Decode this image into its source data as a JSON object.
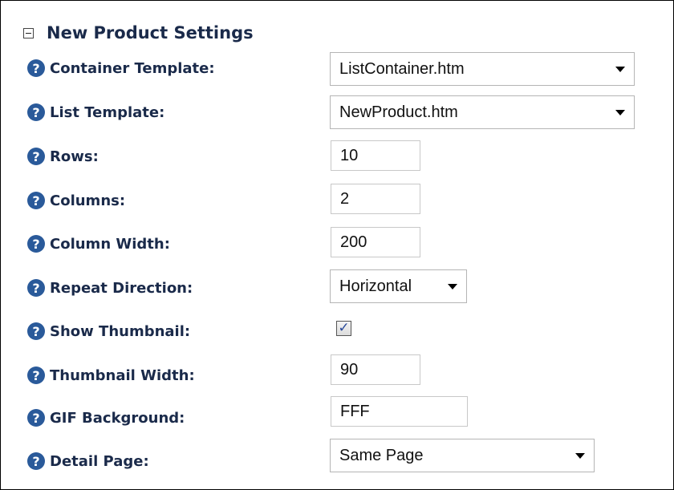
{
  "section": {
    "title": "New Product Settings"
  },
  "help_icon_glyph": "?",
  "fields": {
    "container_template": {
      "label": "Container Template:",
      "value": "ListContainer.htm"
    },
    "list_template": {
      "label": "List Template:",
      "value": "NewProduct.htm"
    },
    "rows": {
      "label": "Rows:",
      "value": "10"
    },
    "columns": {
      "label": "Columns:",
      "value": "2"
    },
    "column_width": {
      "label": "Column Width:",
      "value": "200"
    },
    "repeat_direction": {
      "label": "Repeat Direction:",
      "value": "Horizontal"
    },
    "show_thumbnail": {
      "label": "Show Thumbnail:",
      "checked": true,
      "check_glyph": "✓"
    },
    "thumbnail_width": {
      "label": "Thumbnail Width:",
      "value": "90"
    },
    "gif_background": {
      "label": "GIF Background:",
      "value": "FFF"
    },
    "detail_page": {
      "label": "Detail Page:",
      "value": "Same Page"
    }
  },
  "colors": {
    "label_text": "#1a2a4a",
    "help_icon": "#2a5a9a",
    "control_border": "#c8c8c8"
  }
}
